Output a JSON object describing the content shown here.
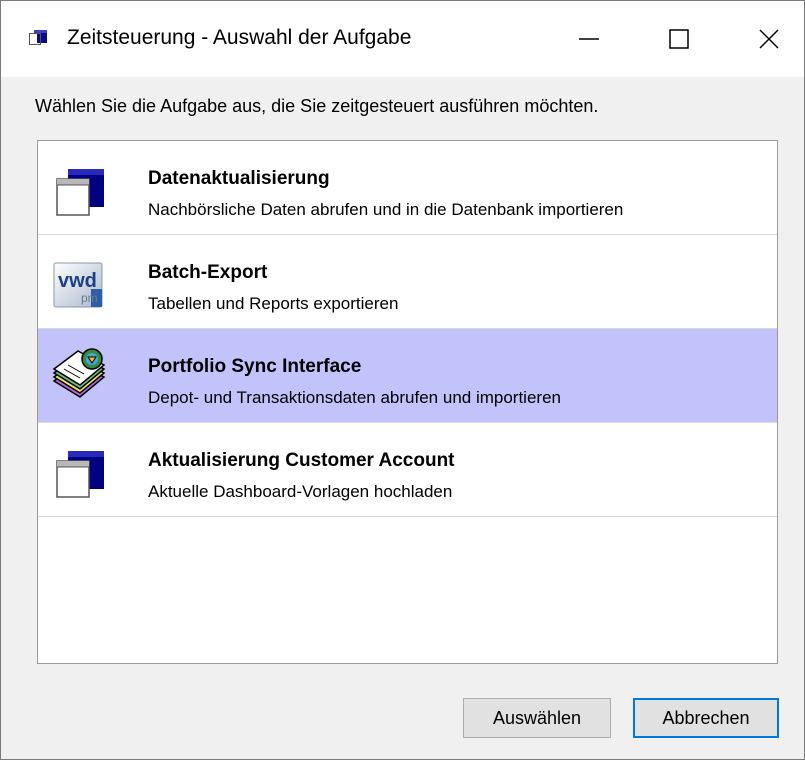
{
  "window": {
    "title": "Zeitsteuerung - Auswahl der Aufgabe",
    "controls": {
      "minimize_icon": "minimize-icon",
      "maximize_icon": "maximize-icon",
      "close_icon": "close-icon"
    }
  },
  "instruction": "Wählen Sie die Aufgabe aus, die Sie zeitgesteuert ausführen möchten.",
  "tasks": [
    {
      "title": "Datenaktualisierung",
      "description": "Nachbörsliche Daten abrufen und in die Datenbank importieren",
      "icon": "window-task-icon",
      "selected": false
    },
    {
      "title": "Batch-Export",
      "description": "Tabellen und Reports exportieren",
      "icon": "vwd-pm-icon",
      "icon_text_main": "vwd",
      "icon_text_sub": "pm",
      "selected": false
    },
    {
      "title": "Portfolio Sync Interface",
      "description": "Depot- und Transaktionsdaten abrufen und importieren",
      "icon": "portfolio-sync-icon",
      "selected": true
    },
    {
      "title": "Aktualisierung Customer Account",
      "description": "Aktuelle Dashboard-Vorlagen hochladen",
      "icon": "window-task-icon",
      "selected": false
    }
  ],
  "buttons": {
    "select_label": "Auswählen",
    "cancel_label": "Abbrechen"
  },
  "colors": {
    "selection": "#c3c3fb",
    "accent": "#0078d7",
    "icon_navy": "#000080"
  }
}
